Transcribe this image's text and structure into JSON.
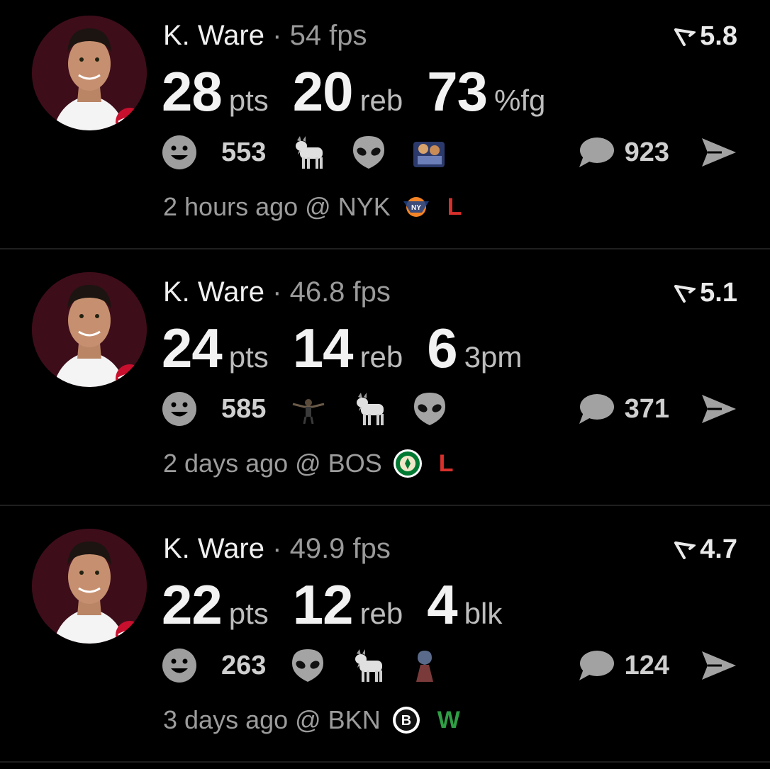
{
  "posts": [
    {
      "player": "K. Ware",
      "separator": "·",
      "fps": "54 fps",
      "rating": "5.8",
      "stats": [
        {
          "value": "28",
          "unit": "pts"
        },
        {
          "value": "20",
          "unit": "reb"
        },
        {
          "value": "73",
          "unit": "%fg"
        }
      ],
      "reaction_count": "553",
      "reaction_icons": [
        "goat-icon",
        "alien-icon",
        "sticker-icon"
      ],
      "comment_count": "923",
      "time": "2 hours ago @ NYK",
      "opponent_logo": "knicks-logo-icon",
      "result": "L",
      "result_color": "#d9302c"
    },
    {
      "player": "K. Ware",
      "separator": "·",
      "fps": "46.8 fps",
      "rating": "5.1",
      "stats": [
        {
          "value": "24",
          "unit": "pts"
        },
        {
          "value": "14",
          "unit": "reb"
        },
        {
          "value": "6",
          "unit": "3pm"
        }
      ],
      "reaction_count": "585",
      "reaction_icons": [
        "flexing-player-icon",
        "goat-icon",
        "alien-icon"
      ],
      "comment_count": "371",
      "time": "2 days ago @ BOS",
      "opponent_logo": "celtics-logo-icon",
      "result": "L",
      "result_color": "#d9302c"
    },
    {
      "player": "K. Ware",
      "separator": "·",
      "fps": "49.9 fps",
      "rating": "4.7",
      "stats": [
        {
          "value": "22",
          "unit": "pts"
        },
        {
          "value": "12",
          "unit": "reb"
        },
        {
          "value": "4",
          "unit": "blk"
        }
      ],
      "reaction_count": "263",
      "reaction_icons": [
        "alien-icon",
        "goat-icon",
        "hooded-figure-icon"
      ],
      "comment_count": "124",
      "time": "3 days ago @ BKN",
      "opponent_logo": "nets-logo-icon",
      "result": "W",
      "result_color": "#2f9e44"
    }
  ]
}
